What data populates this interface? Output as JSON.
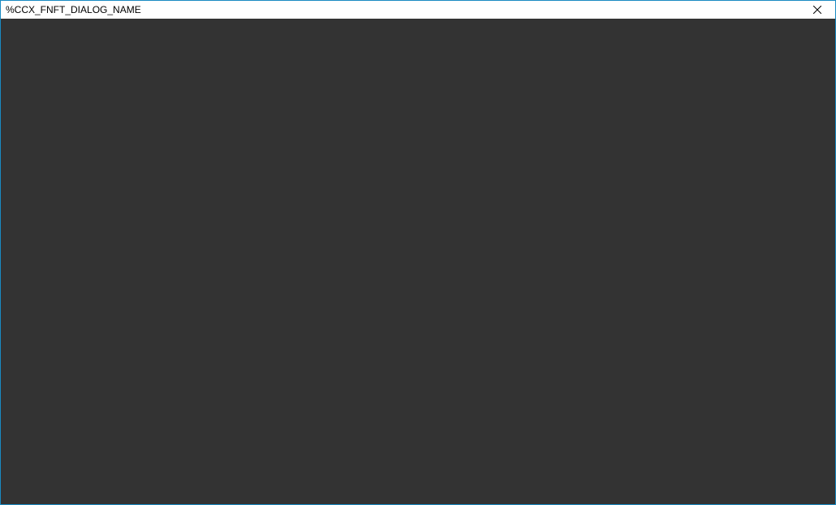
{
  "window": {
    "title": "%CCX_FNFT_DIALOG_NAME"
  },
  "colors": {
    "border": "#1a8ac2",
    "content_bg": "#333333",
    "titlebar_bg": "#ffffff"
  }
}
